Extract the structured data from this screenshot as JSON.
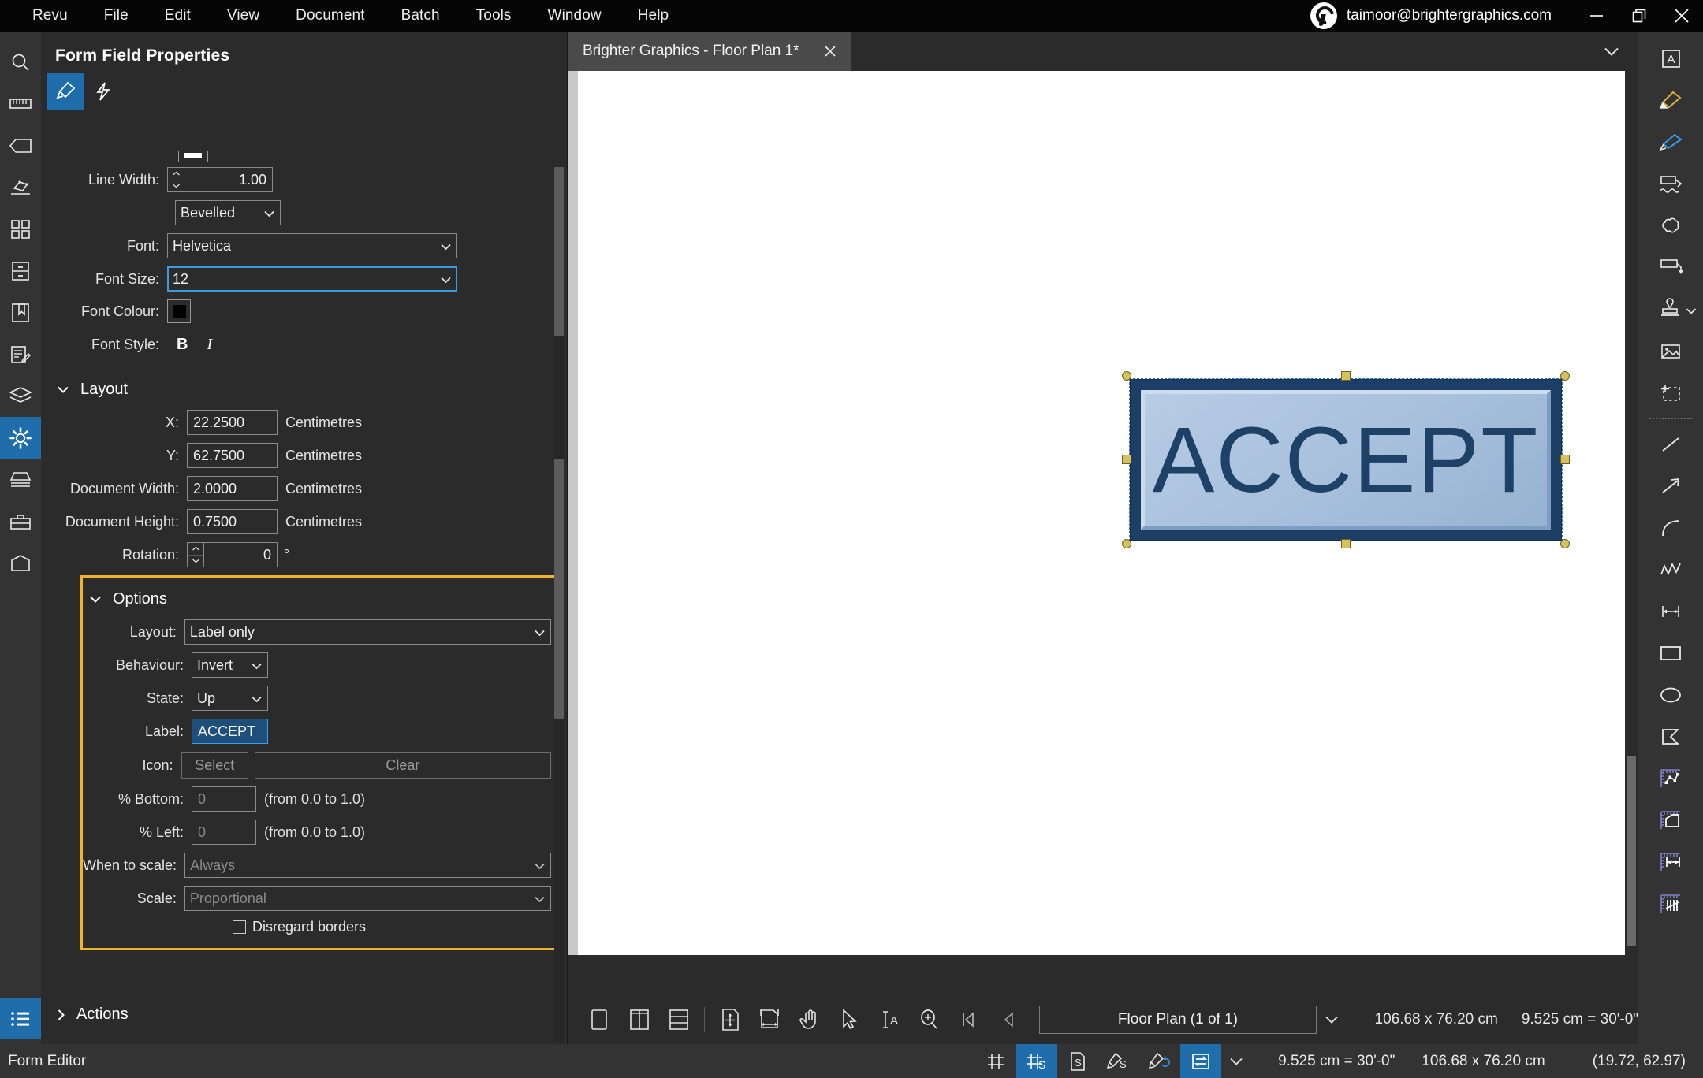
{
  "titlebar": {
    "menu": [
      "Revu",
      "File",
      "Edit",
      "View",
      "Document",
      "Batch",
      "Tools",
      "Window",
      "Help"
    ],
    "account_email": "taimoor@brightergraphics.com",
    "minimize": "minimize-icon",
    "restore": "restore-icon",
    "close": "close-icon"
  },
  "left_rail": {
    "items": [
      {
        "name": "search-icon"
      },
      {
        "name": "measure-ruler-icon"
      },
      {
        "name": "tag-icon"
      },
      {
        "name": "takeoff-icon"
      },
      {
        "name": "thumbnails-grid-icon"
      },
      {
        "name": "file-access-icon"
      },
      {
        "name": "bookmarks-icon"
      },
      {
        "name": "markups-list-icon"
      },
      {
        "name": "layers-icon"
      },
      {
        "name": "properties-gear-icon"
      },
      {
        "name": "studio-icon"
      },
      {
        "name": "toolbox-icon"
      },
      {
        "name": "3d-model-icon"
      }
    ],
    "active_index": 9,
    "bottom_item": {
      "name": "form-list-icon"
    }
  },
  "properties": {
    "title": "Form Field Properties",
    "tabs": [
      {
        "name": "appearance-brush-tab",
        "selected": true
      },
      {
        "name": "actions-bolt-tab",
        "selected": false
      }
    ],
    "appearance": {
      "line_width_label": "Line Width:",
      "line_width_value": "1.00",
      "line_style_value": "Bevelled",
      "font_label": "Font:",
      "font_value": "Helvetica",
      "font_size_label": "Font Size:",
      "font_size_value": "12",
      "font_colour_label": "Font Colour:",
      "font_colour_hex": "#000000",
      "font_style_label": "Font Style:",
      "bold_label": "B",
      "italic_label": "I"
    },
    "layout": {
      "heading": "Layout",
      "x_label": "X:",
      "x_value": "22.2500",
      "y_label": "Y:",
      "y_value": "62.7500",
      "width_label": "Document Width:",
      "width_value": "2.0000",
      "height_label": "Document Height:",
      "height_value": "0.7500",
      "units": "Centimetres",
      "rotation_label": "Rotation:",
      "rotation_value": "0",
      "rotation_unit": "°"
    },
    "options": {
      "heading": "Options",
      "highlight_hex": "#f0b429",
      "layout_label": "Layout:",
      "layout_value": "Label only",
      "behaviour_label": "Behaviour:",
      "behaviour_value": "Invert",
      "state_label": "State:",
      "state_value": "Up",
      "field_label_label": "Label:",
      "field_label_value": "ACCEPT",
      "icon_label": "Icon:",
      "icon_select_button": "Select",
      "icon_clear_button": "Clear",
      "pct_bottom_label": "% Bottom:",
      "pct_bottom_value": "0",
      "pct_bottom_hint": "(from 0.0 to 1.0)",
      "pct_left_label": "% Left:",
      "pct_left_value": "0",
      "pct_left_hint": "(from 0.0 to 1.0)",
      "when_to_scale_label": "When to scale:",
      "when_to_scale_value": "Always",
      "scale_label": "Scale:",
      "scale_value": "Proportional",
      "disregard_borders_label": "Disregard borders",
      "disregard_borders_checked": false
    },
    "actions": {
      "heading": "Actions"
    }
  },
  "document": {
    "tab": {
      "title": "Brighter Graphics - Floor Plan 1*",
      "close": "close-icon"
    },
    "tabbar_chevron": "chevron-down-icon",
    "field": {
      "label": "ACCEPT"
    },
    "toolbar": {
      "icons": [
        {
          "name": "single-page-view-icon"
        },
        {
          "name": "split-vertical-view-icon"
        },
        {
          "name": "split-horizontal-view-icon"
        },
        {
          "name": "fit-page-icon"
        },
        {
          "name": "fit-width-icon"
        },
        {
          "name": "pan-hand-icon"
        },
        {
          "name": "select-arrow-icon"
        },
        {
          "name": "select-text-icon"
        },
        {
          "name": "zoom-in-icon"
        },
        {
          "name": "first-page-icon"
        },
        {
          "name": "previous-page-icon"
        }
      ],
      "page_label": "Floor Plan (1 of 1)",
      "page_chevron": "chevron-down-icon",
      "page_size": "106.68 x 76.20 cm",
      "scale": "9.525 cm = 30'-0\""
    }
  },
  "right_rail": {
    "items": [
      {
        "name": "text-box-icon"
      },
      {
        "name": "highlighter-icon"
      },
      {
        "name": "pen-icon"
      },
      {
        "name": "callout-squiggle-icon"
      },
      {
        "name": "cloud-icon"
      },
      {
        "name": "callout-arrow-icon"
      },
      {
        "name": "stamp-icon",
        "has_chevron": true
      },
      {
        "name": "image-icon"
      },
      {
        "name": "snapshot-icon"
      },
      {
        "name": "line-icon"
      },
      {
        "name": "arrow-icon"
      },
      {
        "name": "arc-icon"
      },
      {
        "name": "polyline-icon"
      },
      {
        "name": "dimension-icon"
      },
      {
        "name": "rectangle-icon"
      },
      {
        "name": "ellipse-icon"
      },
      {
        "name": "polygon-icon"
      },
      {
        "name": "measure-area-icon"
      },
      {
        "name": "measure-perimeter-icon"
      },
      {
        "name": "measure-length-icon"
      },
      {
        "name": "measure-count-icon"
      }
    ]
  },
  "statusbar": {
    "mode": "Form Editor",
    "icons": [
      {
        "name": "grid-icon",
        "active": false
      },
      {
        "name": "snap-to-grid-icon",
        "active": true
      },
      {
        "name": "snap-to-content-icon",
        "active": false
      },
      {
        "name": "snap-to-markup-icon",
        "active": false
      },
      {
        "name": "markup-alignment-icon",
        "active": false
      },
      {
        "name": "sync-views-icon",
        "active": true
      }
    ],
    "chevron": "chevron-down-icon",
    "scale": "9.525 cm = 30'-0\"",
    "page_size": "106.68 x 76.20 cm",
    "cursor_position": "(19.72, 62.97)"
  }
}
